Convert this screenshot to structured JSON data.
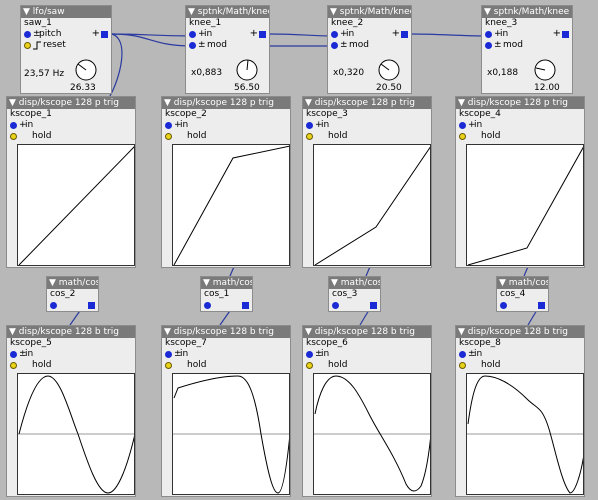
{
  "lfo": {
    "title": "▼ lfo/saw",
    "instance": "saw_1",
    "pitch_label": "pitch",
    "reset_label": "reset",
    "freq": "23,57 Hz",
    "knob_value": "26.33"
  },
  "knees": [
    {
      "title": "▼ sptnk/Math/knee k",
      "instance": "knee_1",
      "in_label": "in",
      "mod_label": "mod",
      "ratio": "x0,883",
      "knob_value": "56.50"
    },
    {
      "title": "▼ sptnk/Math/knee k",
      "instance": "knee_2",
      "in_label": "in",
      "mod_label": "mod",
      "ratio": "x0,320",
      "knob_value": "20.50"
    },
    {
      "title": "▼ sptnk/Math/knee k",
      "instance": "knee_3",
      "in_label": "in",
      "mod_label": "mod",
      "ratio": "x0,188",
      "knob_value": "12.00"
    }
  ],
  "pscopes": [
    {
      "title": "▼ disp/kscope 128 p trig",
      "instance": "kscope_1",
      "in_label": "in",
      "hold_label": "hold"
    },
    {
      "title": "▼ disp/kscope 128 p trig",
      "instance": "kscope_2",
      "in_label": "in",
      "hold_label": "hold"
    },
    {
      "title": "▼ disp/kscope 128 p trig",
      "instance": "kscope_3",
      "in_label": "in",
      "hold_label": "hold"
    },
    {
      "title": "▼ disp/kscope 128 p trig",
      "instance": "kscope_4",
      "in_label": "in",
      "hold_label": "hold"
    }
  ],
  "coses": [
    {
      "title": "▼ math/cos",
      "instance": "cos_2"
    },
    {
      "title": "▼ math/cos",
      "instance": "cos_1"
    },
    {
      "title": "▼ math/cos",
      "instance": "cos_3"
    },
    {
      "title": "▼ math/cos",
      "instance": "cos_4"
    }
  ],
  "bscopes": [
    {
      "title": "▼ disp/kscope 128 b trig",
      "instance": "kscope_5",
      "in_label": "in",
      "hold_label": "hold"
    },
    {
      "title": "▼ disp/kscope 128 b trig",
      "instance": "kscope_7",
      "in_label": "in",
      "hold_label": "hold"
    },
    {
      "title": "▼ disp/kscope 128 b trig",
      "instance": "kscope_6",
      "in_label": "in",
      "hold_label": "hold"
    },
    {
      "title": "▼ disp/kscope 128 b trig",
      "instance": "kscope_8",
      "in_label": "in",
      "hold_label": "hold"
    }
  ],
  "symbols": {
    "plus": "+",
    "pm": "±",
    "plus_in": "+",
    "pm_in": "±"
  },
  "colors": {
    "background": "#b8b8b8",
    "object": "#ededed",
    "title_bar": "#7a7a7a",
    "inlet_blue": "#1a2ad4",
    "hold_yellow": "#e8d21a",
    "wire": "#2a3aa0"
  }
}
